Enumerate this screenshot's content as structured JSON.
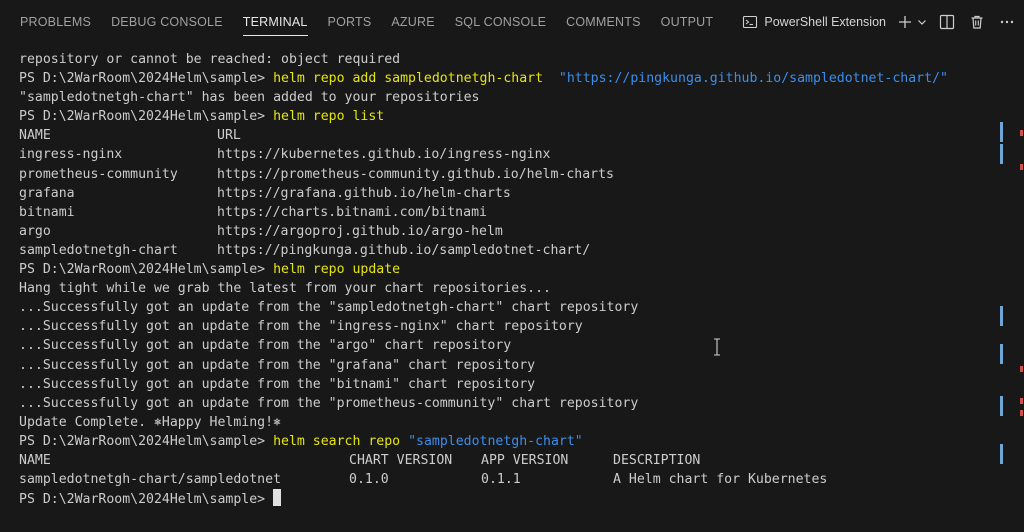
{
  "panel": {
    "tabs": [
      {
        "label": "PROBLEMS"
      },
      {
        "label": "DEBUG CONSOLE"
      },
      {
        "label": "TERMINAL"
      },
      {
        "label": "PORTS"
      },
      {
        "label": "AZURE"
      },
      {
        "label": "SQL CONSOLE"
      },
      {
        "label": "COMMENTS"
      },
      {
        "label": "OUTPUT"
      }
    ],
    "active_tab": "TERMINAL",
    "shell_label": "PowerShell Extension",
    "icons": [
      "terminal-icon",
      "plus-icon",
      "chevron-down-icon",
      "split-terminal-icon",
      "trash-icon",
      "more-icon"
    ]
  },
  "terminal": {
    "prompt": "PS D:\\2WarRoom\\2024Helm\\sample> ",
    "line0": "repository or cannot be reached: object required",
    "cmd1": "helm repo add sampledotnetgh-chart  ",
    "cmd1_arg": "\"https://pingkunga.github.io/sampledotnet-chart/\"",
    "out1": "\"sampledotnetgh-chart\" has been added to your repositories",
    "cmd2": "helm repo list",
    "repo_header": {
      "name": "NAME",
      "url": "URL"
    },
    "repos": [
      {
        "name": "ingress-nginx",
        "url": "https://kubernetes.github.io/ingress-nginx"
      },
      {
        "name": "prometheus-community",
        "url": "https://prometheus-community.github.io/helm-charts"
      },
      {
        "name": "grafana",
        "url": "https://grafana.github.io/helm-charts"
      },
      {
        "name": "bitnami",
        "url": "https://charts.bitnami.com/bitnami"
      },
      {
        "name": "argo",
        "url": "https://argoproj.github.io/argo-helm"
      },
      {
        "name": "sampledotnetgh-chart",
        "url": "https://pingkunga.github.io/sampledotnet-chart/"
      }
    ],
    "cmd3": "helm repo update",
    "update_intro": "Hang tight while we grab the latest from your chart repositories...",
    "updates": [
      "...Successfully got an update from the \"sampledotnetgh-chart\" chart repository",
      "...Successfully got an update from the \"ingress-nginx\" chart repository",
      "...Successfully got an update from the \"argo\" chart repository",
      "...Successfully got an update from the \"grafana\" chart repository",
      "...Successfully got an update from the \"bitnami\" chart repository",
      "...Successfully got an update from the \"prometheus-community\" chart repository"
    ],
    "update_done": "Update Complete. ⎈Happy Helming!⎈",
    "cmd4": "helm search repo ",
    "cmd4_arg": "\"sampledotnetgh-chart\"",
    "search_header": {
      "name": "NAME",
      "chart_version": "CHART VERSION",
      "app_version": "APP VERSION",
      "description": "DESCRIPTION"
    },
    "search_row": {
      "name": "sampledotnetgh-chart/sampledotnet",
      "chart_version": "0.1.0",
      "app_version": "0.1.1",
      "description": "A Helm chart for Kubernetes"
    }
  },
  "colors": {
    "background": "#181818",
    "command": "#e5e510",
    "string": "#3b8eea",
    "text": "#cccccc"
  }
}
